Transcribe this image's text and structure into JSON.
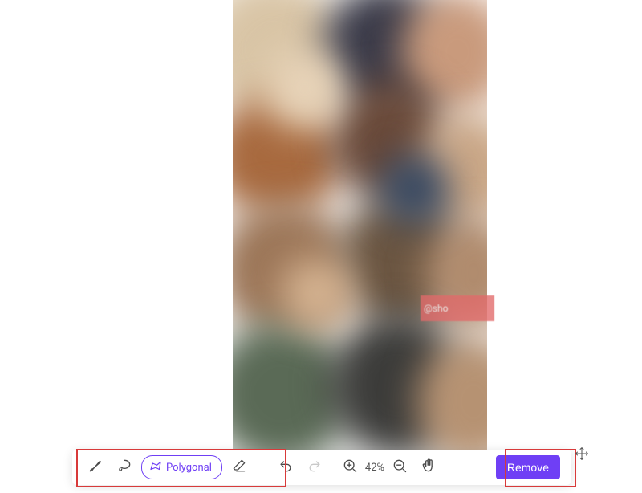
{
  "toolbar": {
    "brush_icon": "brush-icon",
    "lasso_icon": "lasso-icon",
    "polygonal_label": "Polygonal",
    "eraser_icon": "eraser-icon",
    "undo_icon": "undo-icon",
    "redo_icon": "redo-icon",
    "zoom_in_icon": "zoom-in-icon",
    "zoom_label": "42%",
    "zoom_out_icon": "zoom-out-icon",
    "hand_icon": "hand-icon",
    "remove_label": "Remove"
  },
  "watermark": {
    "text": "@sho"
  }
}
